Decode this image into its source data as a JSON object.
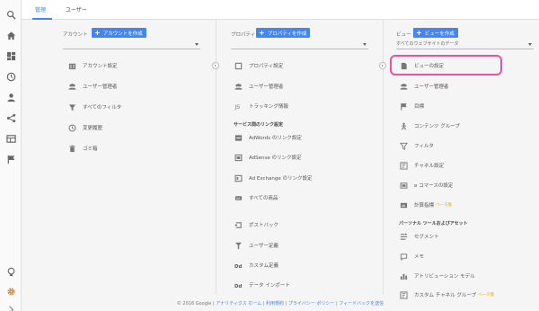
{
  "tabs": {
    "admin": "管理",
    "user": "ユーザー"
  },
  "account": {
    "heading": "アカウント",
    "create_label": "アカウントを作成",
    "items": [
      {
        "label": "アカウント設定",
        "icon": "building-icon"
      },
      {
        "label": "ユーザー管理者",
        "icon": "users-icon"
      },
      {
        "label": "すべてのフィルタ",
        "icon": "filter-icon"
      },
      {
        "label": "変更履歴",
        "icon": "history-icon"
      },
      {
        "label": "ゴミ箱",
        "icon": "trash-icon"
      }
    ]
  },
  "property": {
    "heading": "プロパティ",
    "create_label": "プロパティを作成",
    "items": [
      {
        "label": "プロパティ設定",
        "icon": "square-icon"
      },
      {
        "label": "ユーザー管理者",
        "icon": "users-icon"
      },
      {
        "label": "トラッキング情報",
        "icon": "js-icon"
      }
    ],
    "link_section": "サービス間のリンク設定",
    "links": [
      {
        "label": "AdWords のリンク設定",
        "icon": "adwords-icon"
      },
      {
        "label": "AdSense のリンク設定",
        "icon": "adsense-icon"
      },
      {
        "label": "Ad Exchange のリンク設定",
        "icon": "adexchange-icon"
      },
      {
        "label": "すべての商品",
        "icon": "products-icon"
      }
    ],
    "more": [
      {
        "label": "ポストバック",
        "icon": "postback-icon"
      },
      {
        "label": "ユーザー定義",
        "icon": "user-defined-icon"
      },
      {
        "label": "カスタム定義",
        "icon": "dd-icon"
      },
      {
        "label": "データ インポート",
        "icon": "dd-icon"
      }
    ]
  },
  "view": {
    "heading": "ビュー",
    "create_label": "ビューを作成",
    "selected": "すべてのウェブサイトのデータ",
    "items": [
      {
        "label": "ビューの設定",
        "icon": "document-icon"
      },
      {
        "label": "ユーザー管理者",
        "icon": "users-icon"
      },
      {
        "label": "目標",
        "icon": "flag-icon"
      },
      {
        "label": "コンテンツ グループ",
        "icon": "content-group-icon"
      },
      {
        "label": "フィルタ",
        "icon": "filter-icon"
      },
      {
        "label": "チャネル設定",
        "icon": "channel-icon"
      },
      {
        "label": "e コマースの設定",
        "icon": "cart-icon"
      },
      {
        "label": "計算指標",
        "icon": "calc-icon",
        "badge": "ベータ版"
      }
    ],
    "personal_section": "パーソナル ツールおよびアセット",
    "personal": [
      {
        "label": "セグメント",
        "icon": "segment-icon"
      },
      {
        "label": "メモ",
        "icon": "memo-icon"
      },
      {
        "label": "アトリビューション モデル",
        "icon": "bars-icon"
      },
      {
        "label": "カスタム チャネル グループ",
        "icon": "channel-icon",
        "badge": "ベータ版"
      }
    ]
  },
  "footer": {
    "copyright": "© 2016 Google |",
    "links": [
      "アナリティクス ホーム",
      "利用規約",
      "プライバシー ポリシー",
      "フィードバックを送信"
    ],
    "separator": " | "
  },
  "rail": [
    "search-icon",
    "home-icon",
    "dashboard-icon",
    "clock-icon",
    "person-icon",
    "share-icon",
    "table-icon",
    "flag-icon",
    "bulb-icon",
    "gear-icon"
  ]
}
